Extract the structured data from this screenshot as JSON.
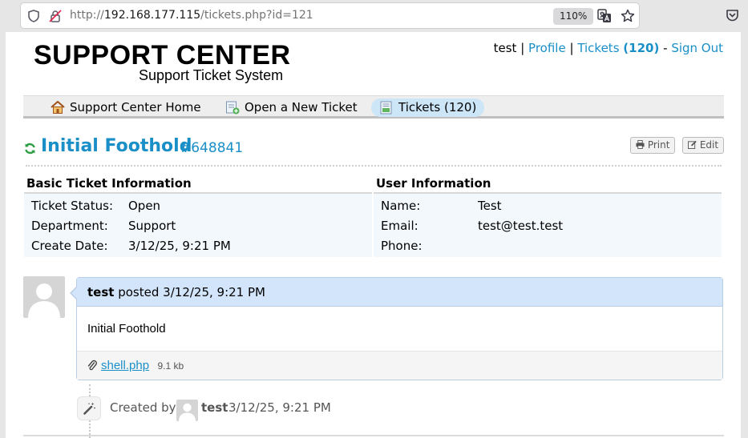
{
  "browser": {
    "url_scheme": "http://",
    "url_host": "192.168.177.115",
    "url_path": "/tickets.php?id=121",
    "zoom": "110%"
  },
  "logo": {
    "title": "SUPPORT CENTER",
    "subtitle": "Support Ticket System"
  },
  "userbar": {
    "username": "test",
    "sep1": "|",
    "profile": "Profile",
    "sep2": "|",
    "tickets": "Tickets",
    "tickets_count": "(120)",
    "dash": "-",
    "signout": "Sign Out"
  },
  "nav": {
    "home": "Support Center Home",
    "new_ticket": "Open a New Ticket",
    "tickets": "Tickets (120)"
  },
  "ticket": {
    "subject": "Initial Foothold",
    "number": "#648841",
    "print": "Print",
    "edit": "Edit"
  },
  "basic_info": {
    "heading": "Basic Ticket Information",
    "rows": [
      {
        "label": "Ticket Status:",
        "value": "Open"
      },
      {
        "label": "Department:",
        "value": "Support"
      },
      {
        "label": "Create Date:",
        "value": "3/12/25, 9:21 PM"
      }
    ]
  },
  "user_info": {
    "heading": "User Information",
    "rows": [
      {
        "label": "Name:",
        "value": "Test"
      },
      {
        "label": "Email:",
        "value": "test@test.test"
      },
      {
        "label": "Phone:",
        "value": ""
      }
    ]
  },
  "message": {
    "author": "test",
    "posted": "posted",
    "date": "3/12/25, 9:21 PM",
    "body": "Initial Foothold",
    "attachment_name": "shell.php",
    "attachment_size": "9.1 kb"
  },
  "event": {
    "created_by": "Created by",
    "user": "test",
    "date": "3/12/25, 9:21 PM"
  }
}
